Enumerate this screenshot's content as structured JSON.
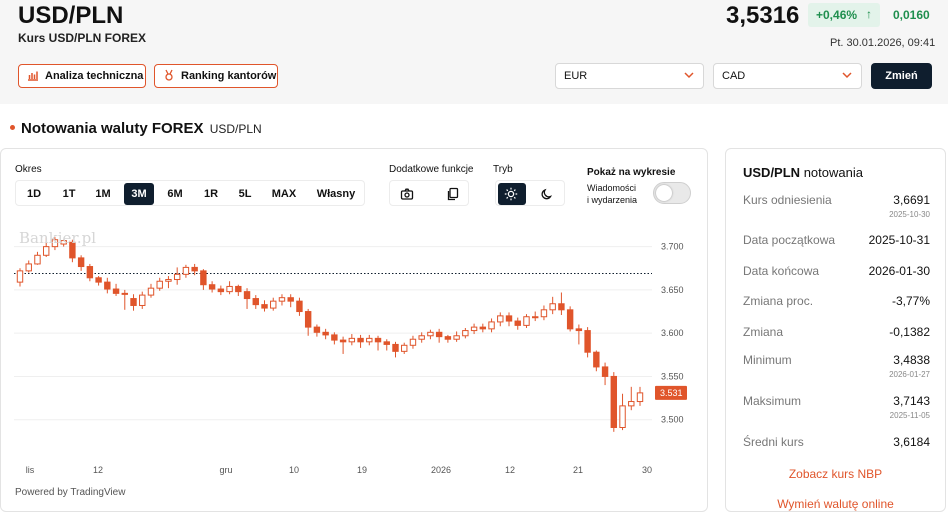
{
  "header": {
    "pair": "USD/PLN",
    "subtitle": "Kurs USD/PLN FOREX",
    "price": "3,5316",
    "change_pct": "+0,46%",
    "change_abs": "0,0160",
    "timestamp": "Pt. 30.01.2026, 09:41",
    "buttons": [
      "Analiza techniczna",
      "Ranking kantorów"
    ],
    "select_from": "EUR",
    "select_to": "CAD",
    "change_button": "Zmień"
  },
  "section": {
    "title": "Notowania waluty FOREX",
    "subtitle": "USD/PLN"
  },
  "controls": {
    "okres_label": "Okres",
    "periods": [
      "1D",
      "1T",
      "1M",
      "3M",
      "6M",
      "1R",
      "5L",
      "MAX",
      "Własny"
    ],
    "active_period": "3M",
    "extra_label": "Dodatkowe funkcje",
    "mode_label": "Tryb",
    "show_label": "Pokaż na wykresie",
    "news_label_1": "Wiadomości",
    "news_label_2": "i wydarzenia",
    "news_toggle": false
  },
  "chart_data": {
    "type": "candlestick",
    "watermark": "Bankier.pl",
    "powered_by": "Powered by TradingView",
    "x_tick_labels": [
      "lis",
      "12",
      "gru",
      "10",
      "19",
      "2026",
      "12",
      "21",
      "30"
    ],
    "y_ticks": [
      3.7,
      3.65,
      3.6,
      3.55,
      3.5
    ],
    "y_tick_labels": [
      "3.700",
      "3.650",
      "3.600",
      "3.550",
      "3.500"
    ],
    "ylim": [
      3.465,
      3.725
    ],
    "reference_line": 3.669,
    "last_price_label": "3.531",
    "last_price": 3.531,
    "colors": {
      "up": "#e0552b",
      "down": "#e0552b",
      "up_fill": "#ffffff",
      "down_fill": "#e0552b",
      "ref": "#0f1e2e"
    },
    "candles": [
      [
        3.659,
        3.672,
        3.654,
        3.675
      ],
      [
        3.672,
        3.68,
        3.67,
        3.684
      ],
      [
        3.68,
        3.69,
        3.679,
        3.694
      ],
      [
        3.69,
        3.7,
        3.688,
        3.711
      ],
      [
        3.7,
        3.708,
        3.696,
        3.711
      ],
      [
        3.703,
        3.707,
        3.7,
        3.708
      ],
      [
        3.705,
        3.687,
        3.682,
        3.708
      ],
      [
        3.687,
        3.677,
        3.672,
        3.69
      ],
      [
        3.677,
        3.664,
        3.66,
        3.68
      ],
      [
        3.664,
        3.659,
        3.655,
        3.666
      ],
      [
        3.659,
        3.651,
        3.646,
        3.664
      ],
      [
        3.651,
        3.646,
        3.643,
        3.657
      ],
      [
        3.646,
        3.646,
        3.627,
        3.65
      ],
      [
        3.64,
        3.632,
        3.626,
        3.645
      ],
      [
        3.632,
        3.644,
        3.628,
        3.648
      ],
      [
        3.644,
        3.652,
        3.641,
        3.657
      ],
      [
        3.652,
        3.66,
        3.649,
        3.664
      ],
      [
        3.66,
        3.662,
        3.652,
        3.666
      ],
      [
        3.662,
        3.668,
        3.656,
        3.676
      ],
      [
        3.668,
        3.676,
        3.664,
        3.679
      ],
      [
        3.676,
        3.672,
        3.667,
        3.68
      ],
      [
        3.672,
        3.656,
        3.65,
        3.674
      ],
      [
        3.656,
        3.651,
        3.647,
        3.66
      ],
      [
        3.651,
        3.648,
        3.644,
        3.655
      ],
      [
        3.648,
        3.654,
        3.645,
        3.66
      ],
      [
        3.654,
        3.648,
        3.643,
        3.656
      ],
      [
        3.648,
        3.64,
        3.628,
        3.652
      ],
      [
        3.64,
        3.633,
        3.628,
        3.644
      ],
      [
        3.633,
        3.629,
        3.625,
        3.638
      ],
      [
        3.629,
        3.637,
        3.626,
        3.641
      ],
      [
        3.637,
        3.641,
        3.632,
        3.645
      ],
      [
        3.641,
        3.637,
        3.63,
        3.645
      ],
      [
        3.637,
        3.625,
        3.62,
        3.641
      ],
      [
        3.625,
        3.607,
        3.597,
        3.628
      ],
      [
        3.607,
        3.601,
        3.596,
        3.61
      ],
      [
        3.601,
        3.598,
        3.593,
        3.605
      ],
      [
        3.598,
        3.592,
        3.587,
        3.601
      ],
      [
        3.592,
        3.59,
        3.576,
        3.596
      ],
      [
        3.59,
        3.594,
        3.586,
        3.599
      ],
      [
        3.594,
        3.59,
        3.583,
        3.598
      ],
      [
        3.59,
        3.594,
        3.586,
        3.598
      ],
      [
        3.594,
        3.59,
        3.58,
        3.597
      ],
      [
        3.59,
        3.587,
        3.58,
        3.593
      ],
      [
        3.587,
        3.579,
        3.572,
        3.59
      ],
      [
        3.579,
        3.586,
        3.576,
        3.589
      ],
      [
        3.586,
        3.593,
        3.582,
        3.597
      ],
      [
        3.593,
        3.597,
        3.589,
        3.601
      ],
      [
        3.597,
        3.601,
        3.593,
        3.604
      ],
      [
        3.601,
        3.596,
        3.589,
        3.605
      ],
      [
        3.596,
        3.593,
        3.589,
        3.598
      ],
      [
        3.593,
        3.597,
        3.59,
        3.602
      ],
      [
        3.597,
        3.603,
        3.594,
        3.606
      ],
      [
        3.603,
        3.607,
        3.599,
        3.611
      ],
      [
        3.607,
        3.605,
        3.601,
        3.611
      ],
      [
        3.605,
        3.613,
        3.601,
        3.617
      ],
      [
        3.613,
        3.62,
        3.608,
        3.624
      ],
      [
        3.62,
        3.614,
        3.608,
        3.624
      ],
      [
        3.614,
        3.609,
        3.604,
        3.618
      ],
      [
        3.609,
        3.619,
        3.606,
        3.622
      ],
      [
        3.619,
        3.619,
        3.614,
        3.625
      ],
      [
        3.619,
        3.627,
        3.615,
        3.632
      ],
      [
        3.627,
        3.634,
        3.622,
        3.642
      ],
      [
        3.634,
        3.627,
        3.621,
        3.647
      ],
      [
        3.627,
        3.605,
        3.602,
        3.631
      ],
      [
        3.605,
        3.603,
        3.587,
        3.61
      ],
      [
        3.603,
        3.578,
        3.572,
        3.607
      ],
      [
        3.578,
        3.561,
        3.556,
        3.58
      ],
      [
        3.561,
        3.55,
        3.54,
        3.566
      ],
      [
        3.55,
        3.491,
        3.486,
        3.555
      ],
      [
        3.491,
        3.516,
        3.488,
        3.53
      ],
      [
        3.516,
        3.521,
        3.511,
        3.538
      ],
      [
        3.521,
        3.531,
        3.516,
        3.538
      ]
    ]
  },
  "sidebar": {
    "title_bold": "USD/PLN",
    "title_rest": "notowania",
    "rows": [
      {
        "label": "Kurs odniesienia",
        "value": "3,6691",
        "sub": "2025-10-30"
      },
      {
        "label": "Data początkowa",
        "value": "2025-10-31",
        "sub": ""
      },
      {
        "label": "Data końcowa",
        "value": "2026-01-30",
        "sub": ""
      },
      {
        "label": "Zmiana proc.",
        "value": "-3,77%",
        "sub": ""
      },
      {
        "label": "Zmiana",
        "value": "-0,1382",
        "sub": ""
      },
      {
        "label": "Minimum",
        "value": "3,4838",
        "sub": "2026-01-27"
      },
      {
        "label": "Maksimum",
        "value": "3,7143",
        "sub": "2025-11-05"
      },
      {
        "label": "Średni kurs",
        "value": "3,6184",
        "sub": ""
      }
    ],
    "link_nbp": "Zobacz kurs NBP",
    "link_exchange": "Wymień walutę online"
  }
}
